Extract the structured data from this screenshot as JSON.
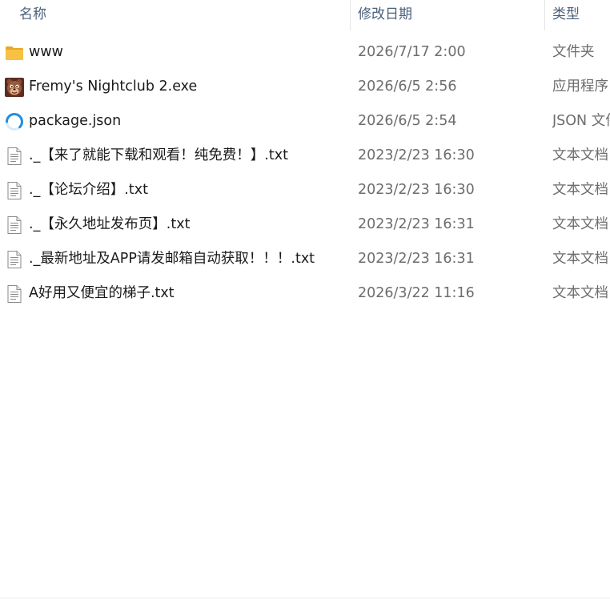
{
  "columns": {
    "name": "名称",
    "date": "修改日期",
    "type": "类型"
  },
  "sort_indicator": "^",
  "files": [
    {
      "name": "www",
      "date": "2026/7/17 2:00",
      "type": "文件夹",
      "icon": "folder-icon"
    },
    {
      "name": "Fremy's Nightclub 2.exe",
      "date": "2026/6/5 2:56",
      "type": "应用程序",
      "icon": "app-icon"
    },
    {
      "name": "package.json",
      "date": "2026/6/5 2:54",
      "type": "JSON 文件",
      "icon": "json-icon"
    },
    {
      "name": "._【来了就能下载和观看！纯免费！】.txt",
      "date": "2023/2/23 16:30",
      "type": "文本文档",
      "icon": "text-file-icon"
    },
    {
      "name": "._【论坛介绍】.txt",
      "date": "2023/2/23 16:30",
      "type": "文本文档",
      "icon": "text-file-icon"
    },
    {
      "name": "._【永久地址发布页】.txt",
      "date": "2023/2/23 16:31",
      "type": "文本文档",
      "icon": "text-file-icon"
    },
    {
      "name": "._最新地址及APP请发邮箱自动获取！！！.txt",
      "date": "2023/2/23 16:31",
      "type": "文本文档",
      "icon": "text-file-icon"
    },
    {
      "name": "A好用又便宜的梯子.txt",
      "date": "2026/3/22 11:16",
      "type": "文本文档",
      "icon": "text-file-icon"
    }
  ],
  "colors": {
    "header_text": "#4c607a",
    "name_text": "#1a1a1a",
    "detail_text": "#6d6d6d",
    "folder": "#f7c244",
    "json_accent": "#1f8fe0"
  }
}
